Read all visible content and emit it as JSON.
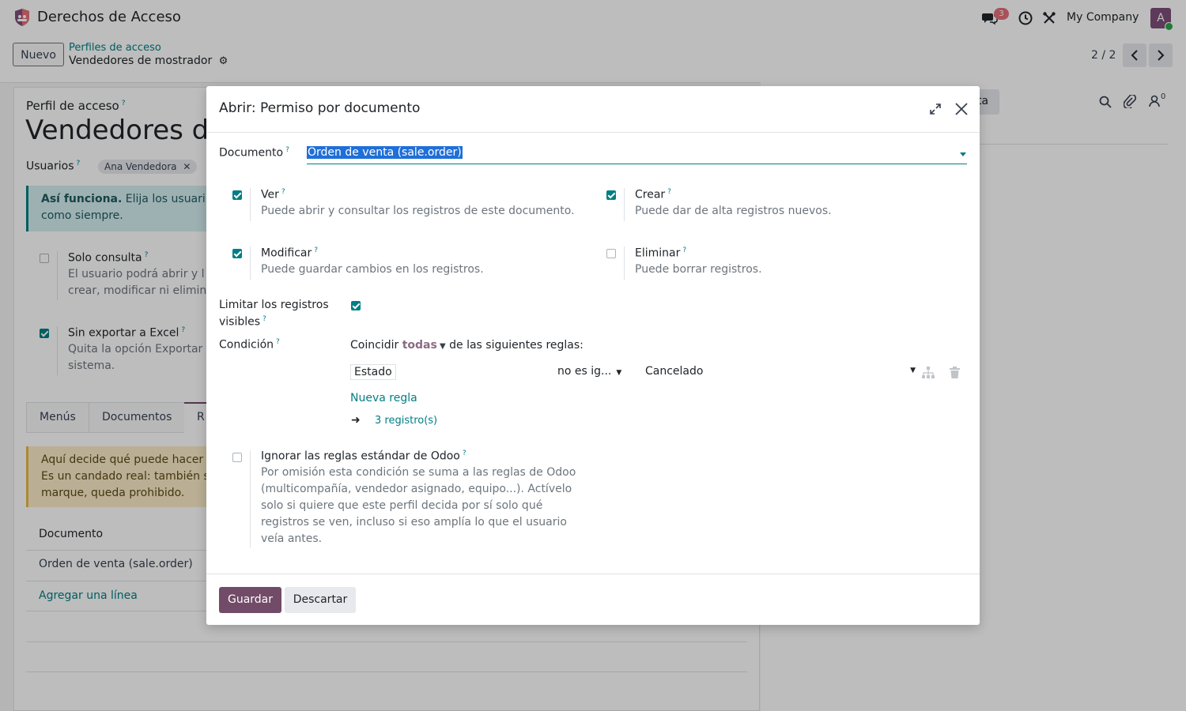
{
  "navbar": {
    "app_title": "Derechos de Acceso",
    "message_count": "3",
    "company": "My Company",
    "avatar_letter": "A"
  },
  "control_panel": {
    "new_button": "Nuevo",
    "breadcrumb_parent": "Perfiles de acceso",
    "breadcrumb_current": "Vendedores de mostrador",
    "pager": "2 / 2"
  },
  "form": {
    "profile_label": "Perfil de acceso",
    "profile_name": "Vendedores d",
    "users_label": "Usuarios",
    "user_tag": "Ana Vendedora",
    "info_strong": "Así funciona.",
    "info_text1": " Elija los usuari",
    "info_text2": "como siempre.",
    "readonly_label": "Solo consulta",
    "readonly_desc1": "El usuario podrá abrir y l",
    "readonly_desc2": "crear, modificar ni elimin",
    "noexport_label": "Sin exportar a Excel",
    "noexport_desc1": "Quita la opción Exportar",
    "noexport_desc2": "sistema.",
    "tabs": [
      "Menús",
      "Documentos",
      "R"
    ],
    "warning1": "Aquí decide qué puede hacer",
    "warning2": "Es un candado real: también s",
    "warning3": "marque, queda prohibido.",
    "col_document": "Documento",
    "row_document": "Orden de venta (sale.order)",
    "add_line": "Agregar una línea",
    "chatter_btn": "ta",
    "follower_count": "0"
  },
  "modal": {
    "title": "Abrir: Permiso por documento",
    "document_label": "Documento",
    "document_value": "Orden de venta (sale.order)",
    "view_label": "Ver",
    "view_desc": "Puede abrir y consultar los registros de este documento.",
    "create_label": "Crear",
    "create_desc": "Puede dar de alta registros nuevos.",
    "edit_label": "Modificar",
    "edit_desc": "Puede guardar cambios en los registros.",
    "delete_label": "Eliminar",
    "delete_desc": "Puede borrar registros.",
    "limit_label1": "Limitar los registros",
    "limit_label2": "visibles",
    "condition_label": "Condición",
    "match_prefix": "Coincidir",
    "match_value": "todas",
    "match_suffix": "de las siguientes reglas:",
    "rule_field": "Estado",
    "rule_operator": "no es ig...",
    "rule_value": "Cancelado",
    "new_rule": "Nueva regla",
    "records_link": "3 registro(s)",
    "ignore_label": "Ignorar las reglas estándar de Odoo",
    "ignore_desc": [
      "Por omisión esta condición se suma a las reglas de Odoo",
      "(multicompañía, vendedor asignado, equipo...). Actívelo",
      "solo si quiere que este perfil decida por sí solo qué",
      "registros se ven, incluso si eso amplía lo que el usuario",
      "veía antes."
    ],
    "save": "Guardar",
    "discard": "Descartar"
  },
  "help_mark": "?",
  "colors": {
    "primary": "#714b67",
    "accent": "#017e84"
  }
}
